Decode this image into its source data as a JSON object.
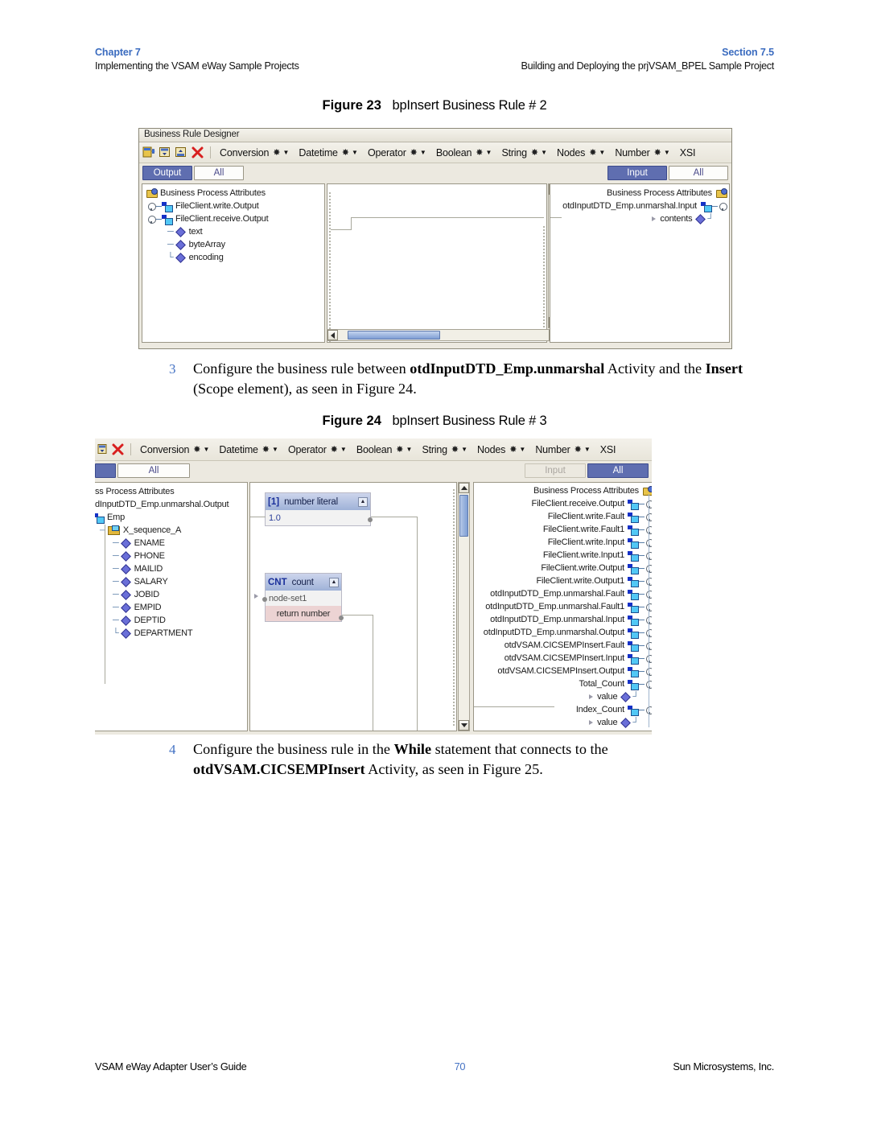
{
  "running_head": {
    "chapter": "Chapter 7",
    "chapter_sub": "Implementing the VSAM eWay Sample Projects",
    "section": "Section 7.5",
    "section_sub": "Building and Deploying the prjVSAM_BPEL Sample Project"
  },
  "figure23": {
    "caption_label": "Figure 23",
    "caption_text": "bpInsert Business Rule # 2",
    "window_title": "Business Rule Designer",
    "toolbar_icons": [
      "map-icon",
      "save-map-icon",
      "validate-icon",
      "delete-icon"
    ],
    "menus": [
      {
        "label": "Conversion"
      },
      {
        "label": "Datetime"
      },
      {
        "label": "Operator"
      },
      {
        "label": "Boolean"
      },
      {
        "label": "String"
      },
      {
        "label": "Nodes"
      },
      {
        "label": "Number"
      },
      {
        "label": "XSI"
      }
    ],
    "left_tabs": [
      {
        "label": "Output",
        "state": "selected"
      },
      {
        "label": "All",
        "state": "unselected"
      }
    ],
    "right_tabs": [
      {
        "label": "Input",
        "state": "selected"
      },
      {
        "label": "All",
        "state": "unselected"
      }
    ],
    "left_tree": [
      {
        "label": "Business Process Attributes",
        "indent": 0,
        "icon": "bpa-icon"
      },
      {
        "label": "FileClient.write.Output",
        "indent": 1,
        "icon": "node-icon"
      },
      {
        "label": "FileClient.receive.Output",
        "indent": 1,
        "icon": "node-icon"
      },
      {
        "label": "text",
        "indent": 2,
        "icon": "diamond-icon"
      },
      {
        "label": "byteArray",
        "indent": 2,
        "icon": "diamond-icon"
      },
      {
        "label": "encoding",
        "indent": 2,
        "icon": "diamond-icon"
      }
    ],
    "right_tree": [
      {
        "label": "Business Process Attributes",
        "icon": "bpa-icon"
      },
      {
        "label": "otdInputDTD_Emp.unmarshal.Input",
        "icon": "node-icon"
      },
      {
        "label": "contents",
        "icon": "diamond-icon"
      }
    ]
  },
  "step3": {
    "number": "3",
    "line1_a": "Configure the business rule between ",
    "line1_b": "otdInputDTD_Emp.unmarshal",
    "line1_c": " Activity and",
    "line2_a": "the ",
    "line2_b": "Insert",
    "line2_c": " (Scope element), as seen in Figure 24."
  },
  "figure24": {
    "caption_label": "Figure 24",
    "caption_text": "bpInsert Business Rule # 3",
    "toolbar_icons": [
      "save-map-icon",
      "delete-icon"
    ],
    "menus": [
      {
        "label": "Conversion"
      },
      {
        "label": "Datetime"
      },
      {
        "label": "Operator"
      },
      {
        "label": "Boolean"
      },
      {
        "label": "String"
      },
      {
        "label": "Nodes"
      },
      {
        "label": "Number"
      },
      {
        "label": "XSI"
      }
    ],
    "left_tabs": [
      {
        "label": "",
        "state": "selected"
      },
      {
        "label": "All",
        "state": "unselected"
      }
    ],
    "right_tabs": [
      {
        "label": "Input",
        "state": "ghost"
      },
      {
        "label": "All",
        "state": "selected"
      }
    ],
    "left_tree": [
      {
        "label": "ss Process Attributes",
        "indent": 0,
        "icon": "none"
      },
      {
        "label": "dInputDTD_Emp.unmarshal.Output",
        "indent": 0,
        "icon": "none"
      },
      {
        "label": "Emp",
        "indent": 0,
        "icon": "node-icon"
      },
      {
        "label": "X_sequence_A",
        "indent": 1,
        "icon": "folder-icon"
      },
      {
        "label": "ENAME",
        "indent": 2,
        "icon": "diamond-icon"
      },
      {
        "label": "PHONE",
        "indent": 2,
        "icon": "diamond-icon"
      },
      {
        "label": "MAILID",
        "indent": 2,
        "icon": "diamond-icon"
      },
      {
        "label": "SALARY",
        "indent": 2,
        "icon": "diamond-icon"
      },
      {
        "label": "JOBID",
        "indent": 2,
        "icon": "diamond-icon"
      },
      {
        "label": "EMPID",
        "indent": 2,
        "icon": "diamond-icon"
      },
      {
        "label": "DEPTID",
        "indent": 2,
        "icon": "diamond-icon"
      },
      {
        "label": "DEPARTMENT",
        "indent": 2,
        "icon": "diamond-icon"
      }
    ],
    "nodes": [
      {
        "tag": "[1]",
        "title": "number literal",
        "rows": [
          {
            "label": "1.0",
            "kind": "value"
          }
        ]
      },
      {
        "tag": "CNT",
        "title": "count",
        "rows": [
          {
            "label": "node-set1",
            "kind": "input"
          },
          {
            "label": "return number",
            "kind": "return"
          }
        ]
      }
    ],
    "right_tree": [
      {
        "label": "Business Process Attributes",
        "icon": "bpa-icon"
      },
      {
        "label": "FileClient.receive.Output",
        "icon": "node-icon"
      },
      {
        "label": "FileClient.write.Fault",
        "icon": "node-icon"
      },
      {
        "label": "FileClient.write.Fault1",
        "icon": "node-icon"
      },
      {
        "label": "FileClient.write.Input",
        "icon": "node-icon"
      },
      {
        "label": "FileClient.write.Input1",
        "icon": "node-icon"
      },
      {
        "label": "FileClient.write.Output",
        "icon": "node-icon"
      },
      {
        "label": "FileClient.write.Output1",
        "icon": "node-icon"
      },
      {
        "label": "otdInputDTD_Emp.unmarshal.Fault",
        "icon": "node-icon"
      },
      {
        "label": "otdInputDTD_Emp.unmarshal.Fault1",
        "icon": "node-icon"
      },
      {
        "label": "otdInputDTD_Emp.unmarshal.Input",
        "icon": "node-icon"
      },
      {
        "label": "otdInputDTD_Emp.unmarshal.Output",
        "icon": "node-icon"
      },
      {
        "label": "otdVSAM.CICSEMPInsert.Fault",
        "icon": "node-icon"
      },
      {
        "label": "otdVSAM.CICSEMPInsert.Input",
        "icon": "node-icon"
      },
      {
        "label": "otdVSAM.CICSEMPInsert.Output",
        "icon": "node-icon"
      },
      {
        "label": "Total_Count",
        "icon": "node-icon"
      },
      {
        "label": "value",
        "icon": "diamond-icon"
      },
      {
        "label": "Index_Count",
        "icon": "node-icon"
      },
      {
        "label": "value",
        "icon": "diamond-icon"
      }
    ]
  },
  "step4": {
    "number": "4",
    "line1_a": "Configure the business rule in the ",
    "line1_b": "While",
    "line1_c": " statement that connects to the",
    "line2_a": "otdVSAM.CICSEMPInsert",
    "line2_b": " Activity, as seen in Figure 25."
  },
  "footer": {
    "left": "VSAM eWay Adapter User’s Guide",
    "page": "70",
    "right": "Sun Microsystems, Inc."
  },
  "colors": {
    "accent_blue": "#3a6bbf",
    "tab_selected": "#5f6eb0",
    "chrome": "#ece9e0",
    "return_row": "#ecd3d3"
  }
}
